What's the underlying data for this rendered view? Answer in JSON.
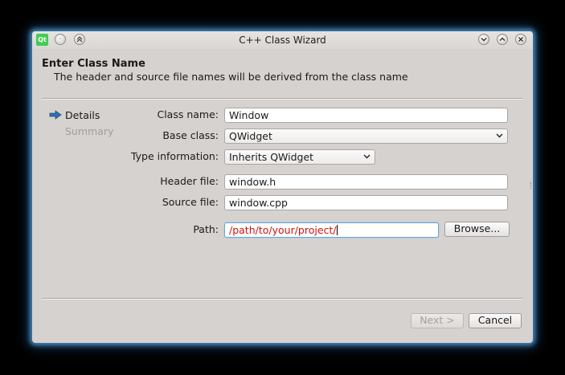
{
  "window": {
    "title": "C++ Class Wizard",
    "icon_text": "Qt"
  },
  "page": {
    "heading": "Enter Class Name",
    "subheading": "The header and source file names will be derived from the class name"
  },
  "steps": [
    {
      "label": "Details",
      "active": true
    },
    {
      "label": "Summary",
      "active": false
    }
  ],
  "form": {
    "class_name": {
      "label": "Class name:",
      "value": "Window"
    },
    "base_class": {
      "label": "Base class:",
      "value": "QWidget"
    },
    "type_information": {
      "label": "Type information:",
      "value": "Inherits QWidget"
    },
    "header_file": {
      "label": "Header file:",
      "value": "window.h"
    },
    "source_file": {
      "label": "Source file:",
      "value": "window.cpp"
    },
    "path": {
      "label": "Path:",
      "value": "/path/to/your/project/"
    }
  },
  "buttons": {
    "browse": "Browse...",
    "next": "Next >",
    "cancel": "Cancel"
  },
  "colors": {
    "path_text": "#d01010",
    "glow": "#5aaae6",
    "arrow": "#2f6fb3"
  }
}
